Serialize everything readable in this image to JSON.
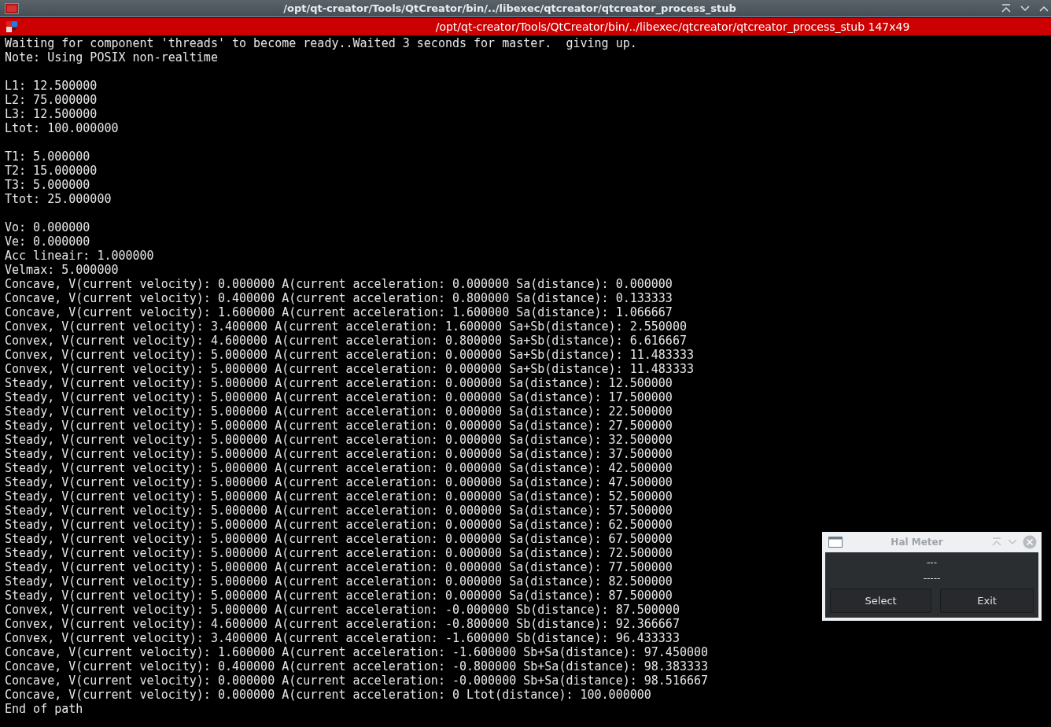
{
  "window": {
    "title": "/opt/qt-creator/Tools/QtCreator/bin/../libexec/qtcreator/qtcreator_process_stub"
  },
  "terminal": {
    "title": "/opt/qt-creator/Tools/QtCreator/bin/../libexec/qtcreator/qtcreator_process_stub 147x49",
    "blocks": [
      [
        "Waiting for component 'threads' to become ready..Waited 3 seconds for master.  giving up.",
        "Note: Using POSIX non-realtime"
      ],
      [
        "L1: 12.500000",
        "L2: 75.000000",
        "L3: 12.500000",
        "Ltot: 100.000000"
      ],
      [
        "T1: 5.000000",
        "T2: 15.000000",
        "T3: 5.000000",
        "Ttot: 25.000000"
      ],
      [
        "Vo: 0.000000",
        "Ve: 0.000000",
        "Acc lineair: 1.000000",
        "Velmax: 5.000000",
        "Concave, V(current velocity): 0.000000 A(current acceleration: 0.000000 Sa(distance): 0.000000",
        "Concave, V(current velocity): 0.400000 A(current acceleration: 0.800000 Sa(distance): 0.133333",
        "Concave, V(current velocity): 1.600000 A(current acceleration: 1.600000 Sa(distance): 1.066667",
        "Convex, V(current velocity): 3.400000 A(current acceleration: 1.600000 Sa+Sb(distance): 2.550000",
        "Convex, V(current velocity): 4.600000 A(current acceleration: 0.800000 Sa+Sb(distance): 6.616667",
        "Convex, V(current velocity): 5.000000 A(current acceleration: 0.000000 Sa+Sb(distance): 11.483333",
        "Convex, V(current velocity): 5.000000 A(current acceleration: 0.000000 Sa+Sb(distance): 11.483333",
        "Steady, V(current velocity): 5.000000 A(current acceleration: 0.000000 Sa(distance): 12.500000",
        "Steady, V(current velocity): 5.000000 A(current acceleration: 0.000000 Sa(distance): 17.500000",
        "Steady, V(current velocity): 5.000000 A(current acceleration: 0.000000 Sa(distance): 22.500000",
        "Steady, V(current velocity): 5.000000 A(current acceleration: 0.000000 Sa(distance): 27.500000",
        "Steady, V(current velocity): 5.000000 A(current acceleration: 0.000000 Sa(distance): 32.500000",
        "Steady, V(current velocity): 5.000000 A(current acceleration: 0.000000 Sa(distance): 37.500000",
        "Steady, V(current velocity): 5.000000 A(current acceleration: 0.000000 Sa(distance): 42.500000",
        "Steady, V(current velocity): 5.000000 A(current acceleration: 0.000000 Sa(distance): 47.500000",
        "Steady, V(current velocity): 5.000000 A(current acceleration: 0.000000 Sa(distance): 52.500000",
        "Steady, V(current velocity): 5.000000 A(current acceleration: 0.000000 Sa(distance): 57.500000",
        "Steady, V(current velocity): 5.000000 A(current acceleration: 0.000000 Sa(distance): 62.500000",
        "Steady, V(current velocity): 5.000000 A(current acceleration: 0.000000 Sa(distance): 67.500000",
        "Steady, V(current velocity): 5.000000 A(current acceleration: 0.000000 Sa(distance): 72.500000",
        "Steady, V(current velocity): 5.000000 A(current acceleration: 0.000000 Sa(distance): 77.500000",
        "Steady, V(current velocity): 5.000000 A(current acceleration: 0.000000 Sa(distance): 82.500000",
        "Steady, V(current velocity): 5.000000 A(current acceleration: 0.000000 Sa(distance): 87.500000",
        "Convex, V(current velocity): 5.000000 A(current acceleration: -0.000000 Sb(distance): 87.500000",
        "Convex, V(current velocity): 4.600000 A(current acceleration: -0.800000 Sb(distance): 92.366667",
        "Convex, V(current velocity): 3.400000 A(current acceleration: -1.600000 Sb(distance): 96.433333",
        "Concave, V(current velocity): 1.600000 A(current acceleration: -1.600000 Sb+Sa(distance): 97.450000",
        "Concave, V(current velocity): 0.400000 A(current acceleration: -0.800000 Sb+Sa(distance): 98.383333",
        "Concave, V(current velocity): 0.000000 A(current acceleration: -0.000000 Sb+Sa(distance): 98.516667",
        "Concave, V(current velocity): 0.000000 A(current acceleration: 0 Ltot(distance): 100.000000",
        "End of path"
      ]
    ]
  },
  "hal_meter": {
    "title": "Hal Meter",
    "value": "---",
    "pin": "-----",
    "buttons": [
      "Select",
      "Exit"
    ]
  }
}
